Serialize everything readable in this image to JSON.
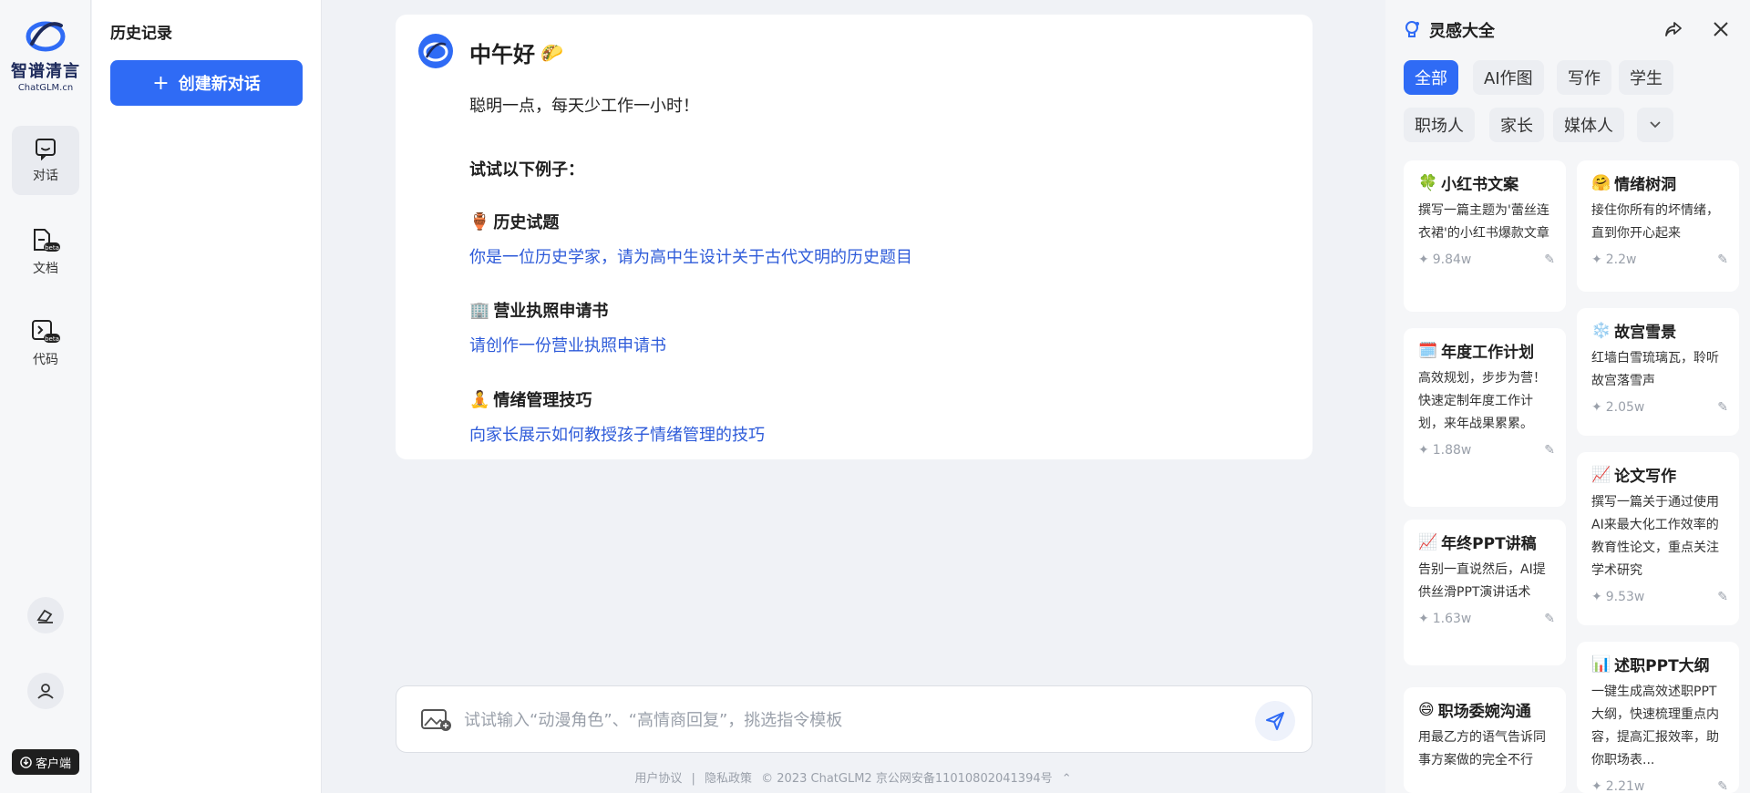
{
  "brand": {
    "title": "智谱清言",
    "subtitle": "ChatGLM.cn"
  },
  "rail": {
    "items": [
      {
        "label": "对话",
        "icon": "chat-icon"
      },
      {
        "label": "文档",
        "icon": "document-beta-icon"
      },
      {
        "label": "代码",
        "icon": "code-beta-icon"
      }
    ],
    "client_label": "客户端"
  },
  "history": {
    "title": "历史记录",
    "new_chat_label": "创建新对话"
  },
  "greeting": {
    "title": "中午好",
    "subtitle": "聪明一点，每天少工作一小时！",
    "try_label": "试试以下例子：",
    "examples": [
      {
        "emoji": "🏺",
        "title": "历史试题",
        "text": "你是一位历史学家，请为高中生设计关于古代文明的历史题目"
      },
      {
        "emoji": "🏢",
        "title": "营业执照申请书",
        "text": "请创作一份营业执照申请书"
      },
      {
        "emoji": "🧘",
        "title": "情绪管理技巧",
        "text": "向家长展示如何教授孩子情绪管理的技巧"
      }
    ]
  },
  "input": {
    "placeholder": "试试输入“动漫角色”、“高情商回复”，挑选指令模板"
  },
  "footer": {
    "agreement": "用户协议",
    "separator": "|",
    "privacy": "隐私政策",
    "copyright": "© 2023 ChatGLM2 京公网安备11010802041394号"
  },
  "inspiration": {
    "title": "灵感大全",
    "chips": [
      "全部",
      "AI作图",
      "写作",
      "学生",
      "职场人",
      "家长",
      "媒体人"
    ],
    "active_chip": "全部",
    "cards_left": [
      {
        "emoji": "🍀",
        "title": "小红书文案",
        "desc": "撰写一篇主题为'蕾丝连衣裙'的小红书爆款文章",
        "count": "9.84w"
      },
      {
        "emoji": "🗓️",
        "title": "年度工作计划",
        "desc": "高效规划，步步为营！快速定制年度工作计划，来年战果累累。",
        "count": "1.88w"
      },
      {
        "emoji": "📈",
        "title": "年终PPT讲稿",
        "desc": "告别一直说然后，AI提供丝滑PPT演讲话术",
        "count": "1.63w"
      },
      {
        "emoji": "😄",
        "title": "职场委婉沟通",
        "desc": "用最乙方的语气告诉同事方案做的完全不行",
        "count": ""
      }
    ],
    "cards_right": [
      {
        "emoji": "🤗",
        "title": "情绪树洞",
        "desc": "接住你所有的坏情绪，直到你开心起来",
        "count": "2.2w"
      },
      {
        "emoji": "❄️",
        "title": "故宫雪景",
        "desc": "红墙白雪琉璃瓦，聆听故宫落雪声",
        "count": "2.05w"
      },
      {
        "emoji": "📈",
        "title": "论文写作",
        "desc": "撰写一篇关于通过使用AI来最大化工作效率的教育性论文，重点关注学术研究",
        "count": "9.53w"
      },
      {
        "emoji": "📊",
        "title": "述职PPT大纲",
        "desc": "一键生成高效述职PPT大纲，快速梳理重点内容，提高汇报效率，助你职场表...",
        "count": "2.21w"
      }
    ]
  },
  "colors": {
    "accent": "#2f6bf5",
    "link": "#2e5bd9",
    "brand_dark": "#1d2a5b"
  }
}
